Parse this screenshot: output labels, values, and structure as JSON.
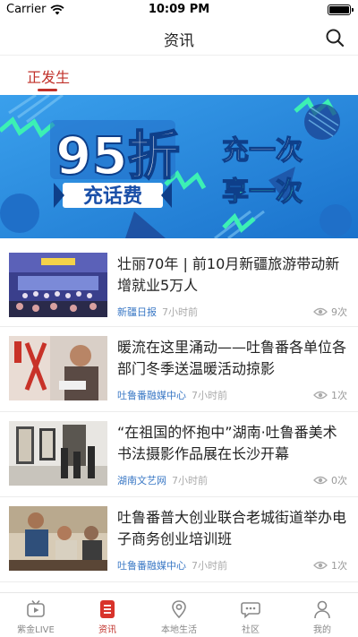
{
  "status_bar": {
    "carrier": "Carrier",
    "time": "10:09 PM"
  },
  "nav": {
    "title": "资讯",
    "search_icon": "search-icon"
  },
  "tabs": [
    {
      "label": "正发生",
      "active": true
    }
  ],
  "banner": {
    "big_text": "95折",
    "sub_text": "充话费",
    "right_line1": "充一次",
    "right_line2": "享一次",
    "colors": {
      "bg": "#2a8ee0",
      "accent_green": "#3cf0b4",
      "accent_blue": "#1f6fc8"
    }
  },
  "news": [
    {
      "title": "壮丽70年 | 前10月新疆旅游带动新增就业5万人",
      "source": "新疆日报",
      "time": "7小时前",
      "views": "9次"
    },
    {
      "title": "暖流在这里涌动——吐鲁番各单位各部门冬季送温暖活动掠影",
      "source": "吐鲁番融媒中心",
      "time": "7小时前",
      "views": "1次"
    },
    {
      "title": "“在祖国的怀抱中”湖南·吐鲁番美术书法摄影作品展在长沙开幕",
      "source": "湖南文艺网",
      "time": "7小时前",
      "views": "0次"
    },
    {
      "title": "吐鲁番普大创业联合老城街道举办电子商务创业培训班",
      "source": "吐鲁番融媒中心",
      "time": "7小时前",
      "views": "1次"
    }
  ],
  "tab_bar": [
    {
      "label": "紫金LIVE",
      "icon": "tv-icon",
      "active": false
    },
    {
      "label": "资讯",
      "icon": "news-icon",
      "active": true
    },
    {
      "label": "本地生活",
      "icon": "location-icon",
      "active": false
    },
    {
      "label": "社区",
      "icon": "chat-icon",
      "active": false
    },
    {
      "label": "我的",
      "icon": "person-icon",
      "active": false
    }
  ]
}
